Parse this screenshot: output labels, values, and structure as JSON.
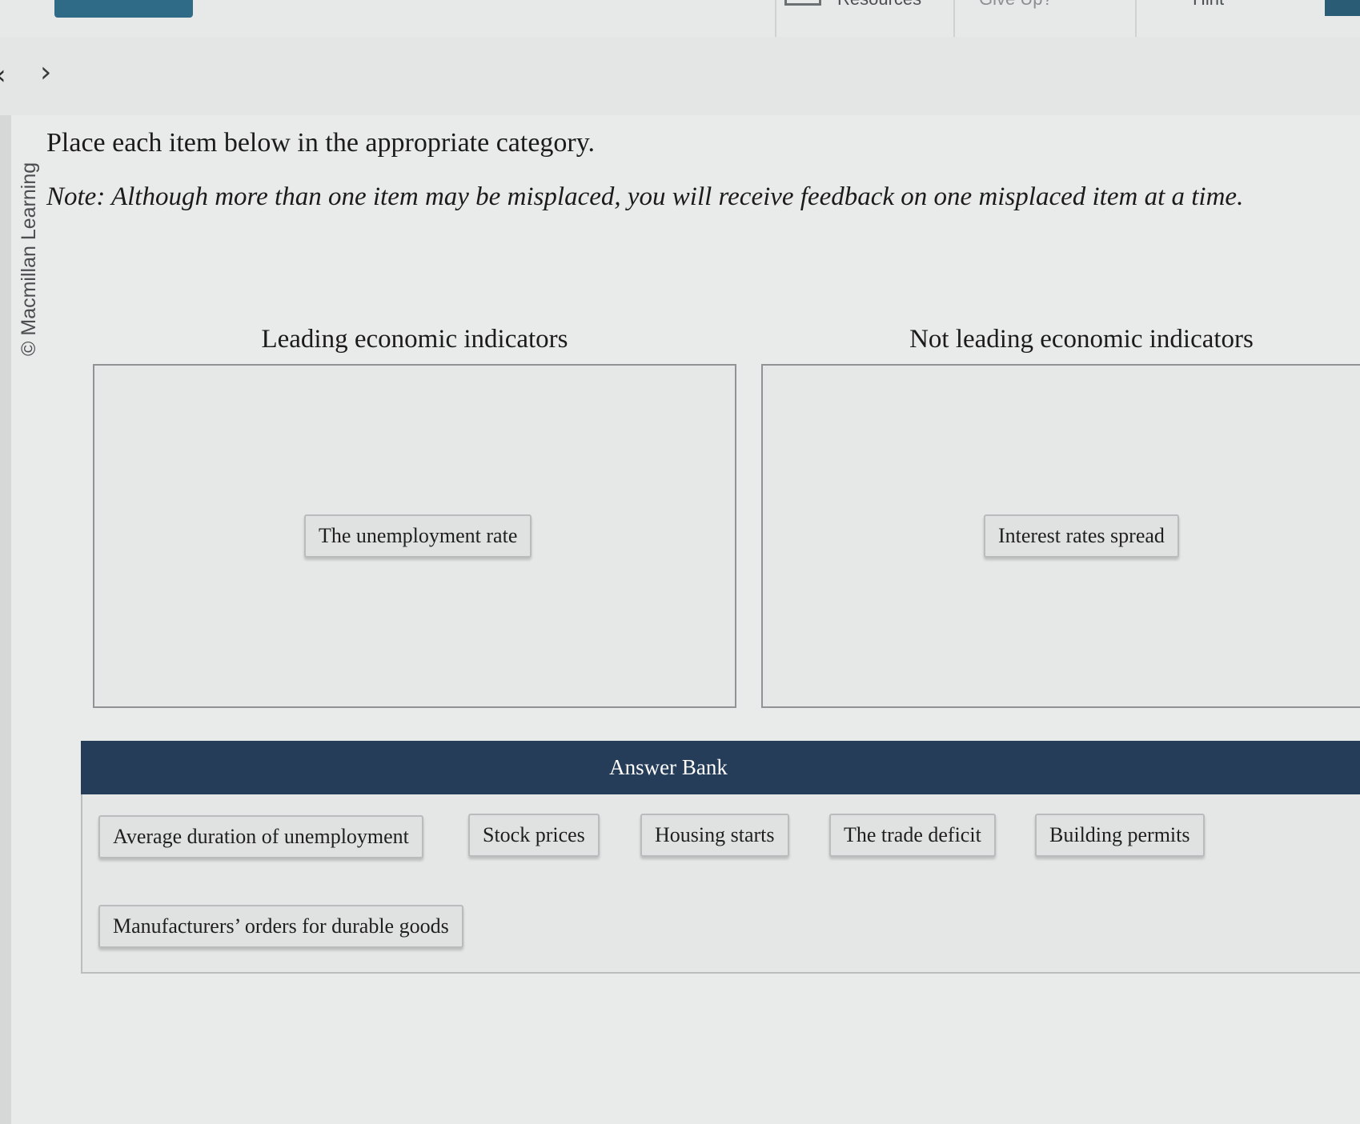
{
  "toolbar": {
    "resources_label": "Resources",
    "give_up_label": "Give Up?",
    "hint_label": "Hint"
  },
  "nav": {
    "prev_symbol": "‹",
    "next_symbol": "›"
  },
  "copyright": "© Macmillan Learning",
  "instructions": "Place each item below in the appropriate category.",
  "note": "Note: Although more than one item may be misplaced, you will receive feedback on one misplaced item at a time.",
  "categories": [
    {
      "title": "Leading economic indicators",
      "items": [
        "The unemployment rate"
      ]
    },
    {
      "title": "Not leading economic indicators",
      "items": [
        "Interest rates spread"
      ]
    }
  ],
  "answer_bank": {
    "title": "Answer Bank",
    "items": [
      "Average duration of unemployment",
      "Stock prices",
      "Housing starts",
      "The trade deficit",
      "Building permits",
      "Manufacturers’ orders for durable goods"
    ]
  },
  "colors": {
    "answer_bank_header": "#253d58",
    "top_button": "#2f6b86"
  }
}
